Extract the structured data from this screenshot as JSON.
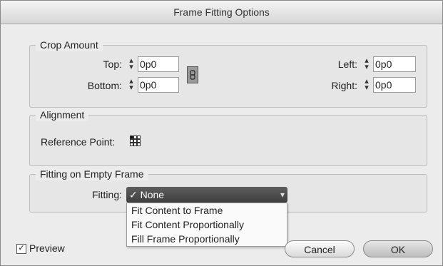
{
  "window": {
    "title": "Frame Fitting Options"
  },
  "crop": {
    "legend": "Crop Amount",
    "top_label": "Top:",
    "top_value": "0p0",
    "bottom_label": "Bottom:",
    "bottom_value": "0p0",
    "left_label": "Left:",
    "left_value": "0p0",
    "right_label": "Right:",
    "right_value": "0p0"
  },
  "alignment": {
    "legend": "Alignment",
    "reference_label": "Reference Point:"
  },
  "fitting": {
    "legend": "Fitting on Empty Frame",
    "label": "Fitting:",
    "selected": "✓ None",
    "options": [
      "Fit Content to Frame",
      "Fit Content Proportionally",
      "Fill Frame Proportionally"
    ]
  },
  "preview": {
    "label": "Preview",
    "checked": true,
    "check_glyph": "✓"
  },
  "buttons": {
    "cancel": "Cancel",
    "ok": "OK"
  },
  "icons": {
    "link": "chain-link-icon",
    "reference": "reference-point-grid-icon",
    "stepper": "stepper-arrows-icon"
  }
}
